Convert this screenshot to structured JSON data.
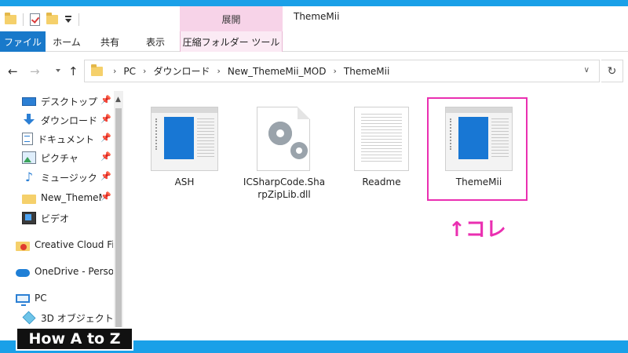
{
  "titlebar": {
    "manage_tab": "展開",
    "window_title": "ThemeMii"
  },
  "ribbon": {
    "tabs": [
      "ファイル",
      "ホーム",
      "共有",
      "表示",
      "圧縮フォルダー ツール"
    ]
  },
  "address_bar": {
    "breadcrumbs": [
      "PC",
      "ダウンロード",
      "New_ThemeMii_MOD",
      "ThemeMii"
    ]
  },
  "sidebar": {
    "items": [
      {
        "label": "デスクトップ",
        "icon": "desktop-icon",
        "pinned": true
      },
      {
        "label": "ダウンロード",
        "icon": "download-icon",
        "pinned": true
      },
      {
        "label": "ドキュメント",
        "icon": "documents-icon",
        "pinned": true
      },
      {
        "label": "ピクチャ",
        "icon": "pictures-icon",
        "pinned": true
      },
      {
        "label": "ミュージック",
        "icon": "music-icon",
        "pinned": true
      },
      {
        "label": "New_ThemeM",
        "icon": "folder-icon",
        "pinned": true
      },
      {
        "label": "ビデオ",
        "icon": "videos-icon",
        "pinned": false
      },
      {
        "label": "Creative Cloud File",
        "icon": "creative-cloud-icon",
        "pinned": false
      },
      {
        "label": "OneDrive - Persor",
        "icon": "onedrive-icon",
        "pinned": false
      },
      {
        "label": "PC",
        "icon": "pc-icon",
        "pinned": false
      },
      {
        "label": "3D オブジェクト",
        "icon": "3d-objects-icon",
        "pinned": false
      }
    ]
  },
  "files": [
    {
      "name": "ASH",
      "icon": "theme-app-icon"
    },
    {
      "name": "ICSharpCode.SharpZipLib.dll",
      "name_line1": "ICSharpCode.Sha",
      "name_line2": "rpZipLib.dll",
      "icon": "dll-gear-icon"
    },
    {
      "name": "Readme",
      "icon": "text-file-icon"
    },
    {
      "name": "ThemeMii",
      "icon": "theme-app-icon",
      "highlighted": true
    }
  ],
  "annotation": {
    "text": "↑コレ",
    "color": "#ea2fb1"
  },
  "watermark": {
    "text": "How A to Z"
  },
  "colors": {
    "accent": "#1979ca",
    "frame": "#1aa0e8",
    "highlight": "#ea2fb1",
    "manage_tab": "#f7d3e8"
  }
}
